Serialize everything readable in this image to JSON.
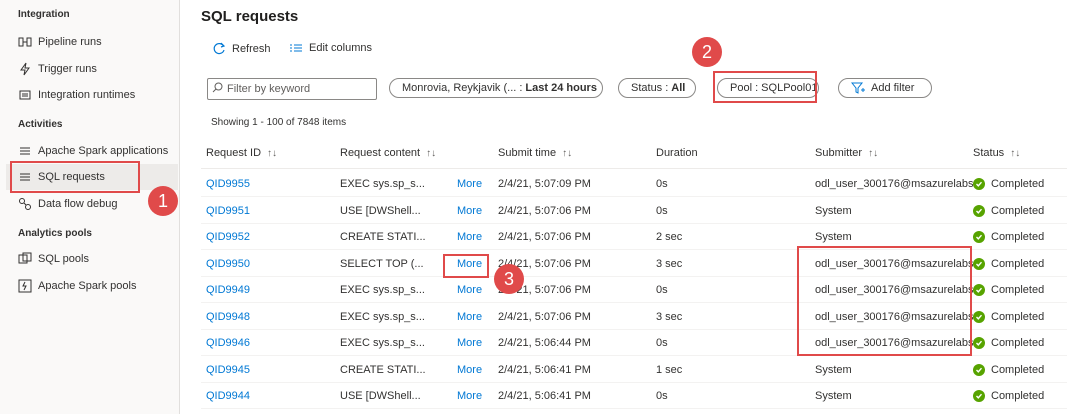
{
  "sidebar": {
    "sections": {
      "integration": "Integration",
      "activities": "Activities",
      "analytics_pools": "Analytics pools"
    },
    "items": [
      {
        "label": "Pipeline runs",
        "icon": "pipeline-icon"
      },
      {
        "label": "Trigger runs",
        "icon": "trigger-icon"
      },
      {
        "label": "Integration runtimes",
        "icon": "runtime-icon"
      },
      {
        "label": "Apache Spark applications",
        "icon": "spark-icon"
      },
      {
        "label": "SQL requests",
        "icon": "sql-requests-icon"
      },
      {
        "label": "Data flow debug",
        "icon": "dataflow-icon"
      },
      {
        "label": "SQL pools",
        "icon": "sql-pool-icon"
      },
      {
        "label": "Apache Spark pools",
        "icon": "spark-pool-icon"
      }
    ]
  },
  "page": {
    "title": "SQL requests",
    "toolbar": {
      "refresh": "Refresh",
      "edit_columns": "Edit columns"
    },
    "search_placeholder": "Filter by keyword",
    "filters": {
      "time_prefix": "Monrovia, Reykjavik (... :",
      "time_value": "Last 24 hours",
      "status_prefix": "Status :",
      "status_value": "All",
      "pool": "Pool : SQLPool01",
      "add_filter": "Add filter"
    },
    "count_text": "Showing 1 - 100 of 7848 items"
  },
  "table": {
    "headers": {
      "request_id": "Request ID",
      "content": "Request content",
      "submit_time": "Submit time",
      "duration": "Duration",
      "submitter": "Submitter",
      "status": "Status"
    },
    "more_label": "More",
    "rows": [
      {
        "id": "QID9955",
        "content": "EXEC sys.sp_s...",
        "time": "2/4/21, 5:07:09 PM",
        "duration": "0s",
        "submitter": "odl_user_300176@msazurelabs",
        "status": "Completed"
      },
      {
        "id": "QID9951",
        "content": "USE [DWShell...",
        "time": "2/4/21, 5:07:06 PM",
        "duration": "0s",
        "submitter": "System",
        "status": "Completed"
      },
      {
        "id": "QID9952",
        "content": "CREATE STATI...",
        "time": "2/4/21, 5:07:06 PM",
        "duration": "2 sec",
        "submitter": "System",
        "status": "Completed"
      },
      {
        "id": "QID9950",
        "content": "SELECT TOP (...",
        "time": "2/4/21, 5:07:06 PM",
        "duration": "3 sec",
        "submitter": "odl_user_300176@msazurelabs",
        "status": "Completed"
      },
      {
        "id": "QID9949",
        "content": "EXEC sys.sp_s...",
        "time": "2/4/21, 5:07:06 PM",
        "duration": "0s",
        "submitter": "odl_user_300176@msazurelabs",
        "status": "Completed"
      },
      {
        "id": "QID9948",
        "content": "EXEC sys.sp_s...",
        "time": "2/4/21, 5:07:06 PM",
        "duration": "3 sec",
        "submitter": "odl_user_300176@msazurelabs",
        "status": "Completed"
      },
      {
        "id": "QID9946",
        "content": "EXEC sys.sp_s...",
        "time": "2/4/21, 5:06:44 PM",
        "duration": "0s",
        "submitter": "odl_user_300176@msazurelabs",
        "status": "Completed"
      },
      {
        "id": "QID9945",
        "content": "CREATE STATI...",
        "time": "2/4/21, 5:06:41 PM",
        "duration": "1 sec",
        "submitter": "System",
        "status": "Completed"
      },
      {
        "id": "QID9944",
        "content": "USE [DWShell...",
        "time": "2/4/21, 5:06:41 PM",
        "duration": "0s",
        "submitter": "System",
        "status": "Completed"
      }
    ]
  },
  "annotations": {
    "badge1": "1",
    "badge2": "2",
    "badge3": "3"
  },
  "colors": {
    "accent": "#0078d4",
    "callout": "#e04a4a",
    "success": "#57a300"
  }
}
